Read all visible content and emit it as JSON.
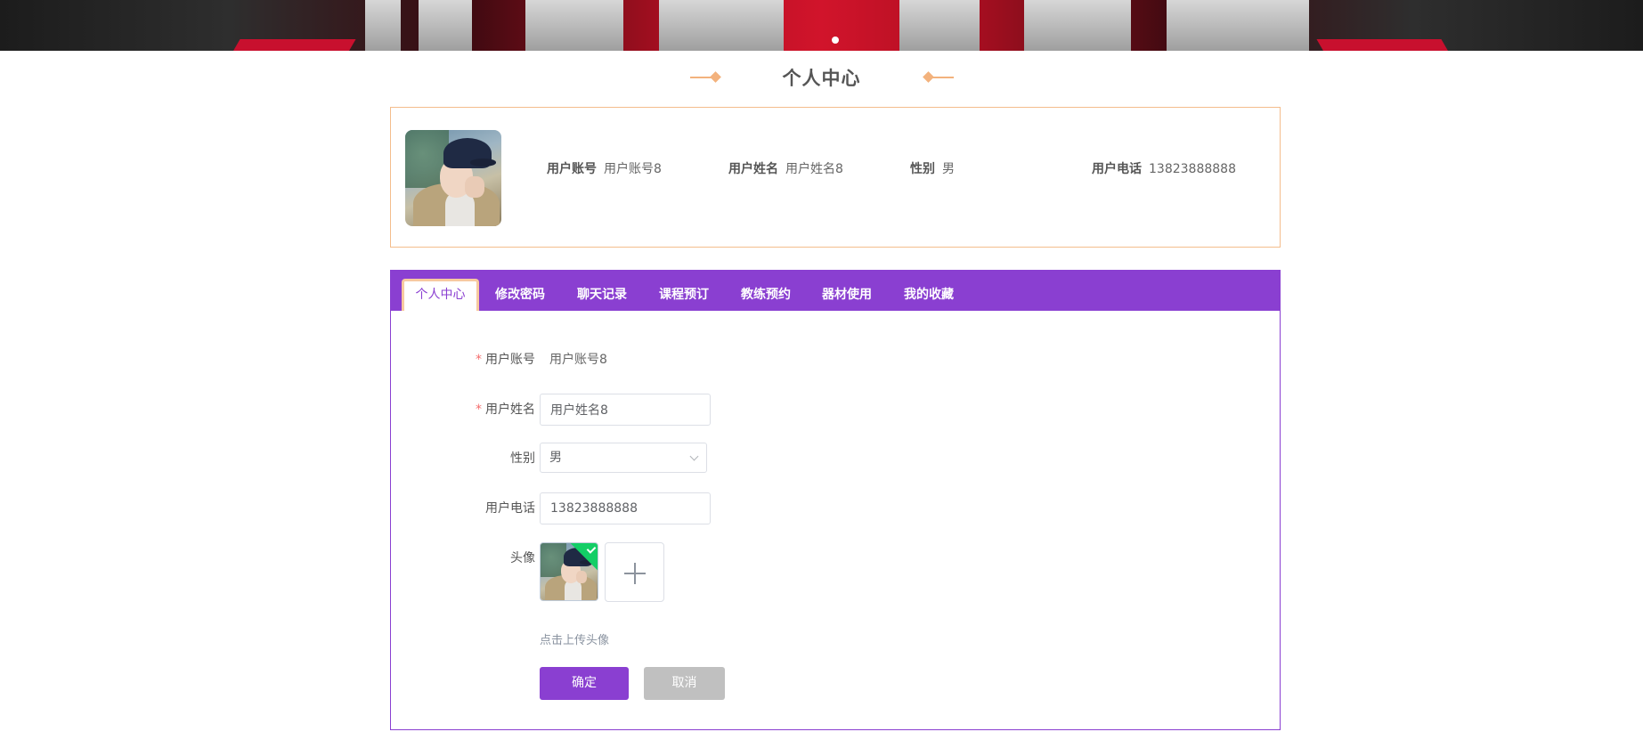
{
  "section_title": "个人中心",
  "profile": {
    "account_label": "用户账号",
    "account_value": "用户账号8",
    "name_label": "用户姓名",
    "name_value": "用户姓名8",
    "gender_label": "性别",
    "gender_value": "男",
    "phone_label": "用户电话",
    "phone_value": "13823888888"
  },
  "tabs": [
    {
      "label": "个人中心",
      "active": true
    },
    {
      "label": "修改密码",
      "active": false
    },
    {
      "label": "聊天记录",
      "active": false
    },
    {
      "label": "课程预订",
      "active": false
    },
    {
      "label": "教练预约",
      "active": false
    },
    {
      "label": "器材使用",
      "active": false
    },
    {
      "label": "我的收藏",
      "active": false
    }
  ],
  "form": {
    "required_mark": "*",
    "account_label": "用户账号",
    "account_value": "用户账号8",
    "name_label": "用户姓名",
    "name_value": "用户姓名8",
    "gender_label": "性别",
    "gender_value": "男",
    "phone_label": "用户电话",
    "phone_value": "13823888888",
    "avatar_label": "头像",
    "upload_hint": "点击上传头像",
    "confirm_label": "确定",
    "cancel_label": "取消"
  },
  "colors": {
    "primary": "#8a3fd1",
    "accent": "#f4bd8c",
    "success": "#13ce66",
    "required": "#f56c6c"
  }
}
